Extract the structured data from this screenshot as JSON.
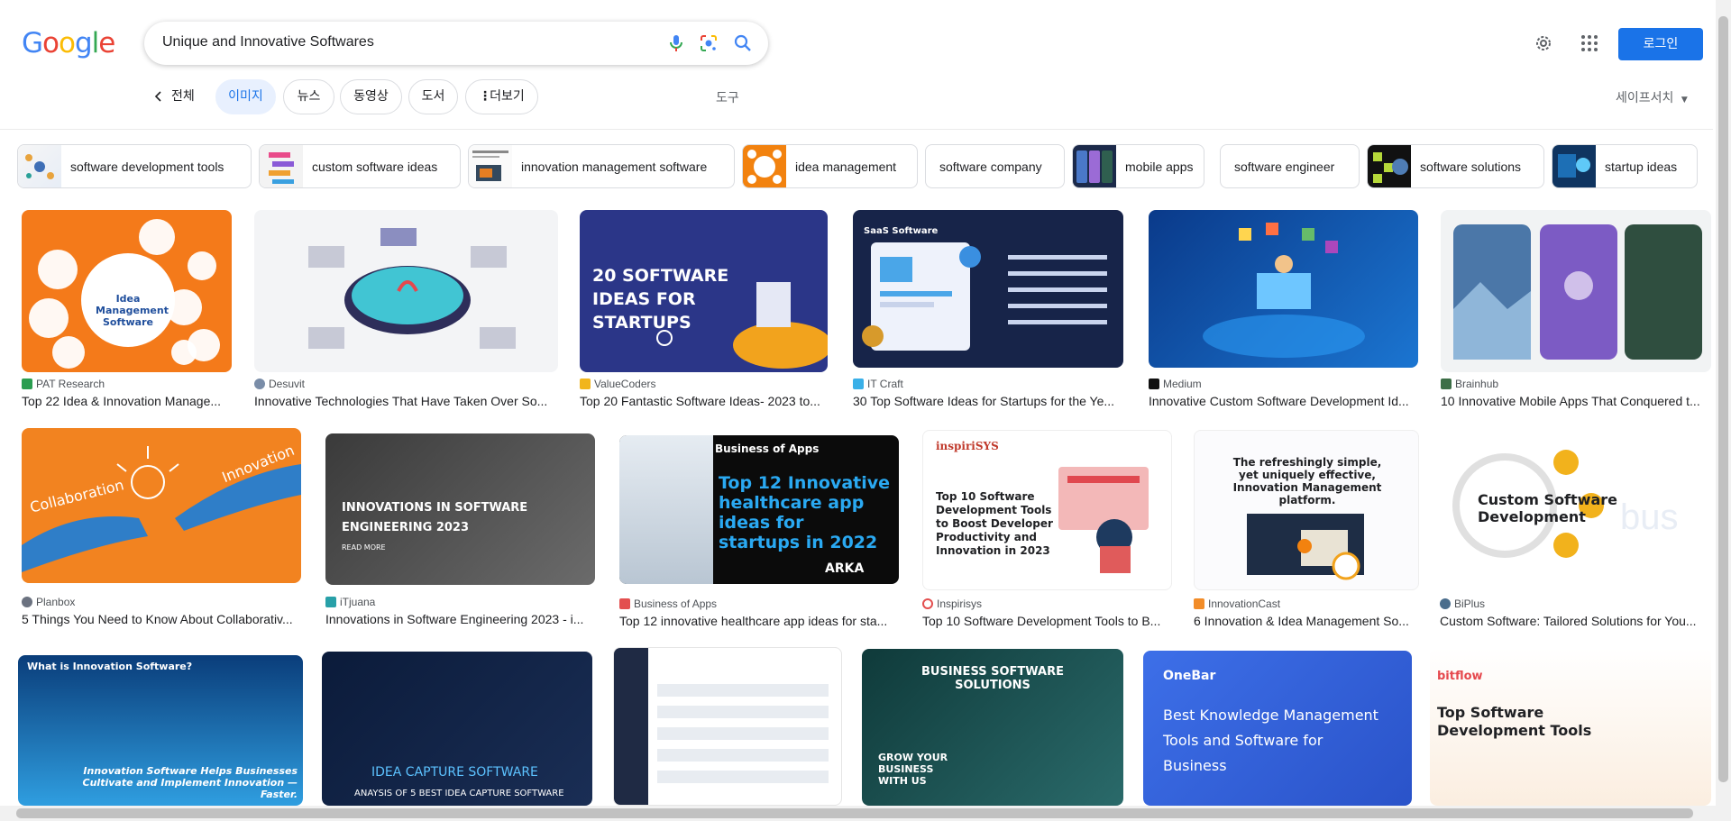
{
  "header": {
    "logo": [
      "G",
      "o",
      "o",
      "g",
      "l",
      "e"
    ],
    "logo_colors": [
      "#4285F4",
      "#EA4335",
      "#FBBC05",
      "#4285F4",
      "#34A853",
      "#EA4335"
    ],
    "query": "Unique and Innovative Softwares",
    "login_label": "로그인",
    "icons": [
      "mic-icon",
      "lens-icon",
      "search-icon",
      "gear-icon",
      "apps-icon"
    ]
  },
  "tabs": {
    "all": "전체",
    "items": [
      "이미지",
      "뉴스",
      "동영상",
      "도서",
      "더보기"
    ],
    "active": "이미지",
    "tools": "도구",
    "safesearch": "세이프서치"
  },
  "chips": [
    "software development tools",
    "custom software ideas",
    "innovation management software",
    "idea management",
    "software company",
    "mobile apps",
    "software engineer",
    "software solutions",
    "startup ideas"
  ],
  "results": [
    {
      "source": "PAT Research",
      "title": "Top 22 Idea & Innovation Manage...",
      "img_text": "Idea Management Software"
    },
    {
      "source": "Desuvit",
      "title": "Innovative Technologies That Have Taken Over So...",
      "img_text": ""
    },
    {
      "source": "ValueCoders",
      "title": "Top 20 Fantastic Software Ideas- 2023 to...",
      "img_text": "20 SOFTWARE IDEAS FOR STARTUPS"
    },
    {
      "source": "IT Craft",
      "title": "30 Top Software Ideas for Startups for the Ye...",
      "img_text": "SaaS Software"
    },
    {
      "source": "Medium",
      "title": "Innovative Custom Software Development Id...",
      "img_text": ""
    },
    {
      "source": "Brainhub",
      "title": "10 Innovative Mobile Apps That Conquered t...",
      "img_text": ""
    },
    {
      "source": "Planbox",
      "title": "5 Things You Need to Know About Collaborativ...",
      "img_text": "Collaboration"
    },
    {
      "source": "iTjuana",
      "title": "Innovations in Software Engineering 2023 - i...",
      "img_text": "INNOVATIONS IN SOFTWARE ENGINEERING 2023"
    },
    {
      "source": "Business of Apps",
      "title": "Top 12 innovative healthcare app ideas for sta...",
      "img_text": "Top 12 Innovative healthcare app ideas for startups in 2022"
    },
    {
      "source": "Inspirisys",
      "title": "Top 10 Software Development Tools to B...",
      "img_text": "Top 10 Software Development Tools to Boost Developer Productivity and Innovation in 2023"
    },
    {
      "source": "InnovationCast",
      "title": "6 Innovation & Idea Management So...",
      "img_text": "The refreshingly simple, yet uniquely effective, Innovation Management platform."
    },
    {
      "source": "BiPlus",
      "title": "Custom Software: Tailored Solutions for You...",
      "img_text": "Custom Software Development"
    },
    {
      "source": "",
      "title": "",
      "img_text": "What is Innovation Software?"
    },
    {
      "source": "",
      "title": "",
      "img_text": "IDEA CAPTURE SOFTWARE"
    },
    {
      "source": "",
      "title": "",
      "img_text": ""
    },
    {
      "source": "",
      "title": "",
      "img_text": "BUSINESS SOFTWARE SOLUTIONS"
    },
    {
      "source": "",
      "title": "",
      "img_text": "Best Knowledge Management Tools and Software for Business"
    },
    {
      "source": "",
      "title": "",
      "img_text": "Top Software Development Tools"
    }
  ]
}
